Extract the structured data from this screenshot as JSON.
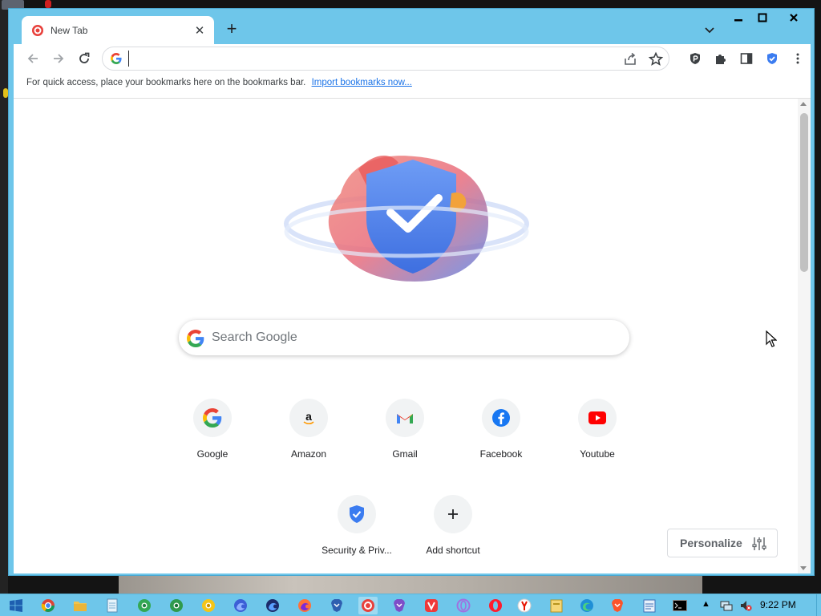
{
  "window": {
    "tab_title": "New Tab",
    "close_tab_glyph": "✕",
    "new_tab_glyph": "+"
  },
  "toolbar": {
    "omnibox_value": "",
    "omnibox_placeholder": ""
  },
  "bookmarks_bar": {
    "hint": "For quick access, place your bookmarks here on the bookmarks bar.",
    "import_link": "Import bookmarks now..."
  },
  "search": {
    "placeholder": "Search Google"
  },
  "shortcuts": [
    {
      "label": "Google",
      "icon": "google-g-icon"
    },
    {
      "label": "Amazon",
      "icon": "amazon-icon"
    },
    {
      "label": "Gmail",
      "icon": "gmail-icon"
    },
    {
      "label": "Facebook",
      "icon": "facebook-icon"
    },
    {
      "label": "Youtube",
      "icon": "youtube-icon"
    },
    {
      "label": "Security & Priv...",
      "icon": "shield-check-icon"
    },
    {
      "label": "Add shortcut",
      "icon": "plus-icon"
    }
  ],
  "personalize": {
    "label": "Personalize"
  },
  "taskbar": {
    "clock": "9:22 PM",
    "apps": [
      "windows-start-icon",
      "chrome-icon",
      "file-explorer-icon",
      "notepad-icon",
      "chrome-green-icon",
      "chrome-green-icon",
      "chrome-yellow-icon",
      "firefox-dev-icon",
      "firefox-nightly-icon",
      "firefox-icon",
      "brave-icon",
      "security-browser-icon",
      "tor-icon",
      "vivaldi-icon",
      "opera-gx-icon",
      "opera-icon",
      "yandex-icon",
      "file-manager-icon",
      "edge-icon",
      "brave-icon",
      "wordpad-icon",
      "cmd-icon"
    ]
  },
  "colors": {
    "accent": "#6ec6ea",
    "link": "#1a73e8",
    "shield_blue": "#3b7cf0"
  }
}
